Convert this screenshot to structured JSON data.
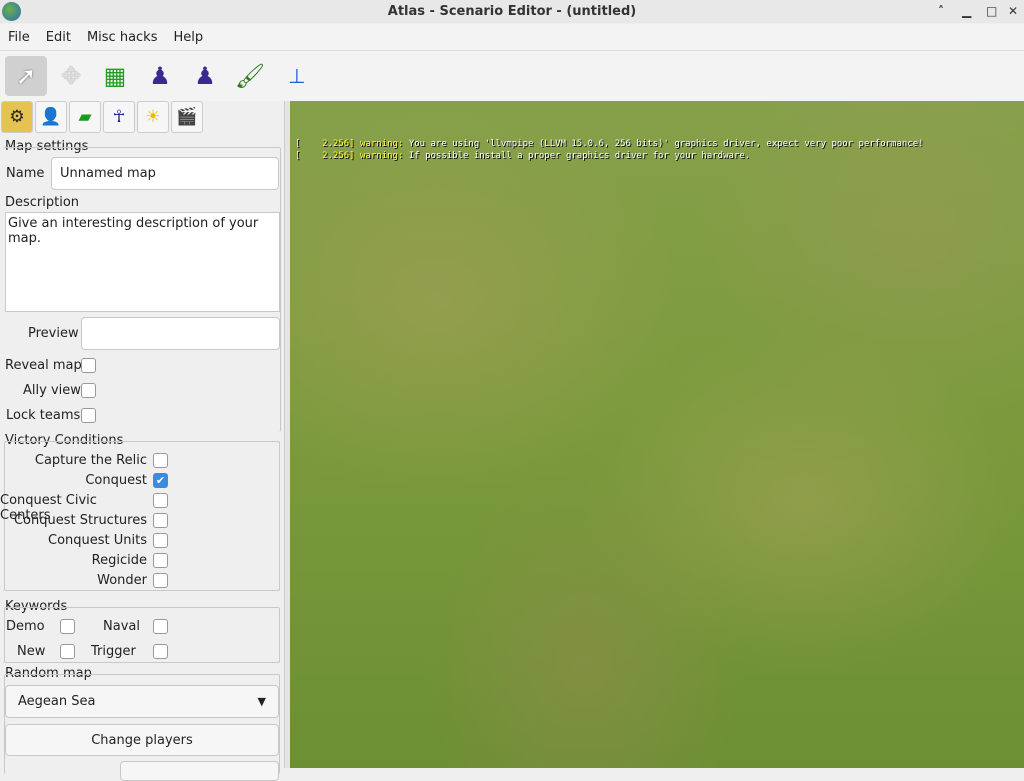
{
  "window": {
    "title": "Atlas - Scenario Editor - (untitled)",
    "minimize": "▁",
    "maximize": "□",
    "close": "✕",
    "restore": "˄"
  },
  "menu": [
    "File",
    "Edit",
    "Misc hacks",
    "Help"
  ],
  "log": [
    {
      "time": "[    2.256]",
      "level": "warning:",
      "msg": "You are using 'llvmpipe (LLVM 15.0.6, 256 bits)' graphics driver, expect very poor performance!"
    },
    {
      "time": "[    2.256]",
      "level": "warning:",
      "msg": "If possible install a proper graphics driver for your hardware."
    }
  ],
  "map_settings": {
    "heading": "Map settings",
    "name_label": "Name",
    "name_value": "Unnamed map",
    "description_label": "Description",
    "description_value": "Give an interesting description of your map.",
    "preview_label": "Preview",
    "preview_value": "",
    "reveal_map": "Reveal map",
    "ally_view": "Ally view",
    "lock_teams": "Lock teams"
  },
  "victory": {
    "heading": "Victory Conditions",
    "items": [
      {
        "label": "Capture the Relic",
        "checked": false
      },
      {
        "label": "Conquest",
        "checked": true
      },
      {
        "label": "Conquest Civic Centers",
        "checked": false
      },
      {
        "label": "Conquest Structures",
        "checked": false
      },
      {
        "label": "Conquest Units",
        "checked": false
      },
      {
        "label": "Regicide",
        "checked": false
      },
      {
        "label": "Wonder",
        "checked": false
      }
    ]
  },
  "keywords": {
    "heading": "Keywords",
    "demo": "Demo",
    "naval": "Naval",
    "new": "New",
    "trigger": "Trigger"
  },
  "random_map": {
    "heading": "Random map",
    "selected": "Aegean Sea",
    "change_players": "Change players"
  }
}
